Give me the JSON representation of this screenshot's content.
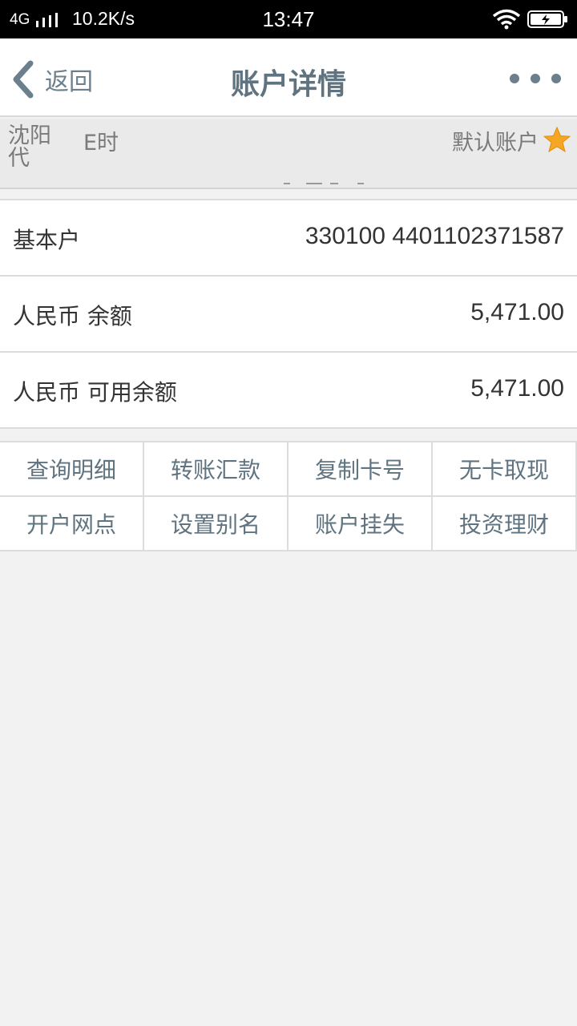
{
  "status_bar": {
    "network": "4G",
    "speed": "10.2K/s",
    "time": "13:47"
  },
  "nav": {
    "back_label": "返回",
    "title": "账户详情"
  },
  "account": {
    "owner": "沈阳代",
    "card_type": "E时",
    "default_label": "默认账户"
  },
  "details": [
    {
      "label": "基本户",
      "value": "330100 4401102371587"
    },
    {
      "label": "人民币 余额",
      "value": "5,471.00"
    },
    {
      "label": "人民币 可用余额",
      "value": "5,471.00"
    }
  ],
  "actions": [
    "查询明细",
    "转账汇款",
    "复制卡号",
    "无卡取现",
    "开户网点",
    "设置别名",
    "账户挂失",
    "投资理财"
  ],
  "colors": {
    "nav_text": "#5f7380",
    "star": "#f5a623",
    "background": "#f2f2f2"
  },
  "icons": {
    "back": "chevron-left-icon",
    "more": "more-dots-icon",
    "default": "star-icon",
    "wifi": "wifi-icon",
    "battery": "battery-charging-icon",
    "signal": "signal-icon"
  }
}
